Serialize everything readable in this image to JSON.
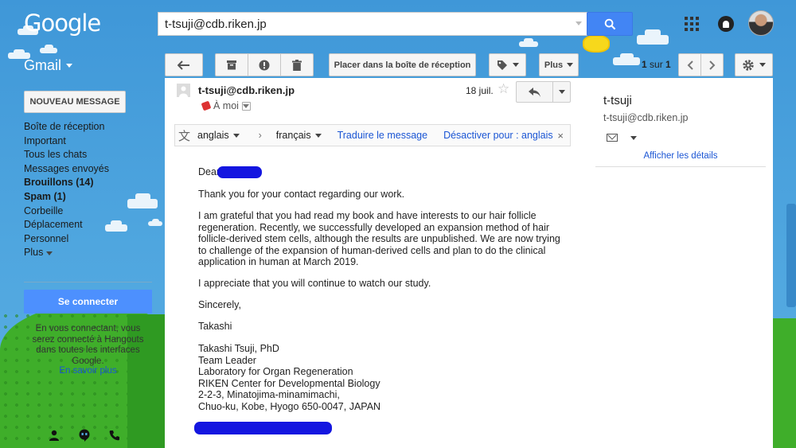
{
  "topbar": {
    "logo_text": "Google",
    "search_value": "t-tsuji@cdb.riken.jp"
  },
  "toolbar": {
    "app_name": "Gmail",
    "move_inbox_label": "Placer dans la boîte de réception",
    "more_label": "Plus",
    "pager_range": "1",
    "pager_sep": "sur",
    "pager_total": "1"
  },
  "sidebar": {
    "compose_label": "NOUVEAU MESSAGE",
    "items": [
      {
        "label": "Boîte de réception"
      },
      {
        "label": "Important"
      },
      {
        "label": "Tous les chats"
      },
      {
        "label": "Messages envoyés"
      },
      {
        "label": "Brouillons (14)"
      },
      {
        "label": "Spam (1)"
      },
      {
        "label": "Corbeille"
      },
      {
        "label": "Déplacement"
      },
      {
        "label": "Personnel"
      }
    ],
    "more_label": "Plus",
    "connect_label": "Se connecter",
    "hangouts_text": "En vous connectant, vous serez connecté à Hangouts dans toutes les interfaces Google.",
    "learn_more": "En savoir plus"
  },
  "message": {
    "sender_email": "t-tsuji@cdb.riken.jp",
    "to_label": "À moi",
    "date": "18 juil.",
    "translate": {
      "source_lang": "anglais",
      "target_lang": "français",
      "translate_link": "Traduire le message",
      "disable_link": "Désactiver pour : anglais",
      "close": "×"
    },
    "greeting": "Dear",
    "para1": "Thank you for your contact regarding our work.",
    "para2": "I am grateful that you had read my book and have interests to our hair follicle regeneration.  Recently, we successfully developed an expansion method of hair follicle-derived stem cells, although the results are unpublished.  We are now trying to challenge of the expansion of human-derived cells and plan to do the clinical application in human at March 2019.",
    "para3": "I appreciate that you will continue to watch our study.",
    "closing": "Sincerely,",
    "signoff": "Takashi",
    "signature": [
      "Takashi Tsuji, PhD",
      "Team Leader",
      "Laboratory for Organ Regeneration",
      "RIKEN Center for Developmental Biology",
      "2-2-3, Minatojima-minamimachi,",
      "Chuo-ku, Kobe, Hyogo 650-0047, JAPAN"
    ]
  },
  "contact": {
    "name": "t-tsuji",
    "email": "t-tsuji@cdb.riken.jp",
    "details_link": "Afficher les détails"
  },
  "colors": {
    "accent": "#4285f4",
    "connect_button": "#4d90fe",
    "link": "#1a55d4",
    "redaction": "#1416e0"
  },
  "icons": [
    "search-icon",
    "apps-icon",
    "notifications-icon",
    "back-arrow-icon",
    "archive-icon",
    "spam-icon",
    "trash-icon",
    "label-icon",
    "settings-icon",
    "reply-icon",
    "star-icon",
    "translate-icon",
    "mail-icon",
    "person-icon",
    "hangouts-icon",
    "phone-icon"
  ]
}
